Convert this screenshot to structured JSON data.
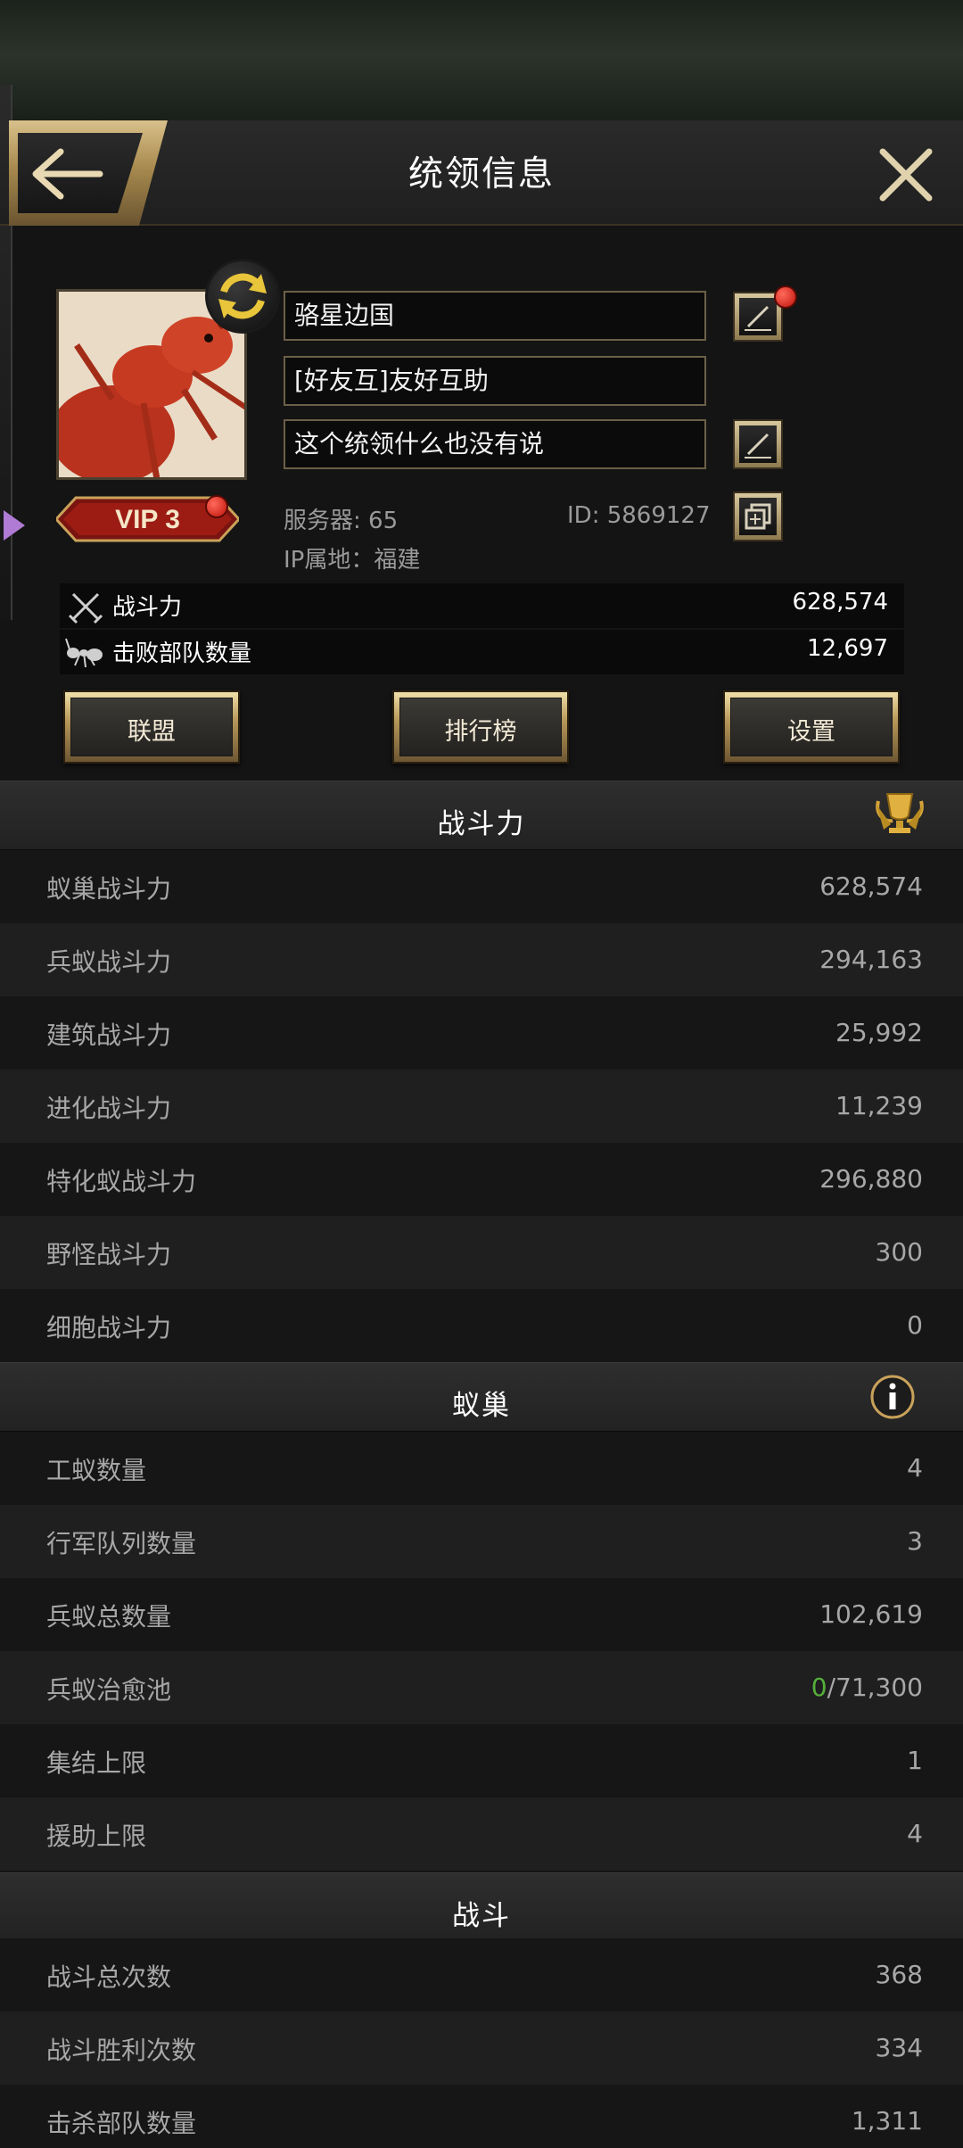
{
  "header": {
    "title": "统领信息"
  },
  "profile": {
    "name": "骆星边国",
    "alliance": "[好友互]友好互助",
    "signature": "这个统领什么也没有说",
    "vip": "VIP 3",
    "server": "服务器: 65",
    "id": "ID: 5869127",
    "ip_location": "IP属地：福建"
  },
  "summary": {
    "power_label": "战斗力",
    "power_value": "628,574",
    "defeated_label": "击败部队数量",
    "defeated_value": "12,697"
  },
  "actions": {
    "alliance": "联盟",
    "ranking": "排行榜",
    "settings": "设置"
  },
  "sections": {
    "power": {
      "title": "战斗力",
      "rows": [
        {
          "label": "蚁巢战斗力",
          "value": "628,574"
        },
        {
          "label": "兵蚁战斗力",
          "value": "294,163"
        },
        {
          "label": "建筑战斗力",
          "value": "25,992"
        },
        {
          "label": "进化战斗力",
          "value": "11,239"
        },
        {
          "label": "特化蚁战斗力",
          "value": "296,880"
        },
        {
          "label": "野怪战斗力",
          "value": "300"
        },
        {
          "label": "细胞战斗力",
          "value": "0"
        }
      ]
    },
    "nest": {
      "title": "蚁巢",
      "rows": [
        {
          "label": "工蚁数量",
          "value": "4"
        },
        {
          "label": "行军队列数量",
          "value": "3"
        },
        {
          "label": "兵蚁总数量",
          "value": "102,619"
        },
        {
          "label": "兵蚁治愈池",
          "value_current": "0",
          "value_total": "/71,300"
        },
        {
          "label": "集结上限",
          "value": "1"
        },
        {
          "label": "援助上限",
          "value": "4"
        }
      ]
    },
    "battle": {
      "title": "战斗",
      "rows": [
        {
          "label": "战斗总次数",
          "value": "368"
        },
        {
          "label": "战斗胜利次数",
          "value": "334"
        },
        {
          "label": "击杀部队数量",
          "value": "1,311"
        }
      ]
    }
  },
  "colors": {
    "accent_gold": "#b8985a",
    "green": "#55b03a",
    "notify_red": "#c0120a"
  }
}
